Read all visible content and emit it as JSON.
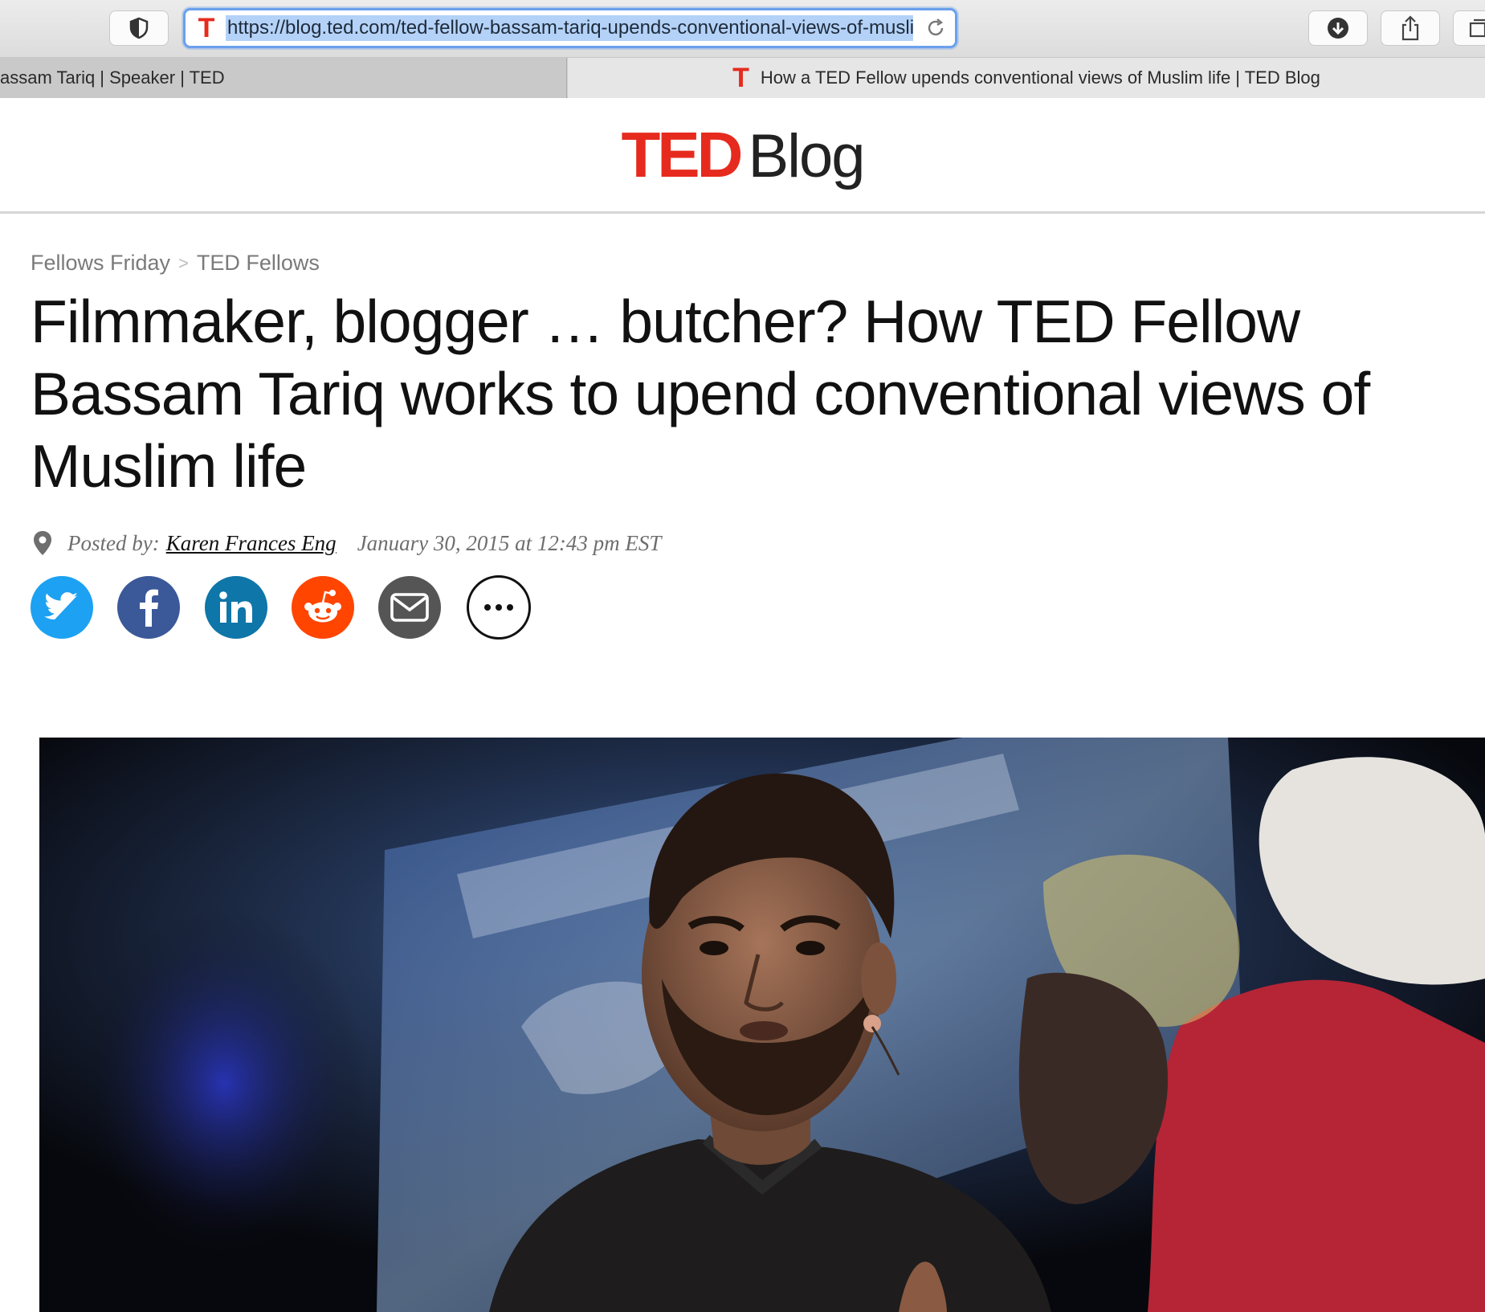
{
  "browser": {
    "url": "https://blog.ted.com/ted-fellow-bassam-tariq-upends-conventional-views-of-muslim-life/",
    "tabs": [
      {
        "title": "assam Tariq | Speaker | TED",
        "active": false
      },
      {
        "title": "How a TED Fellow upends conventional views of Muslim life | TED Blog",
        "active": true
      }
    ],
    "favicon_letter": "T"
  },
  "site": {
    "logo_ted": "TED",
    "logo_blog": "Blog",
    "brand_color": "#e62b1e"
  },
  "breadcrumb": {
    "parent": "Fellows Friday",
    "separator": ">",
    "current": "TED Fellows"
  },
  "article": {
    "title": "Filmmaker, blogger … butcher? How TED Fellow Bassam Tariq works to upend conventional views of Muslim life",
    "posted_by_label": "Posted by:",
    "author": "Karen Frances Eng",
    "date": "January 30, 2015 at 12:43 pm EST"
  },
  "share": [
    {
      "name": "twitter",
      "icon": "twitter-bird-icon",
      "color": "#1da1f2"
    },
    {
      "name": "facebook",
      "icon": "facebook-f-icon",
      "color": "#3b5998"
    },
    {
      "name": "linkedin",
      "icon": "linkedin-in-icon",
      "color": "#0e76a8"
    },
    {
      "name": "reddit",
      "icon": "reddit-alien-icon",
      "color": "#ff4500"
    },
    {
      "name": "email",
      "icon": "envelope-icon",
      "color": "#555555"
    },
    {
      "name": "more",
      "icon": "ellipsis-icon",
      "color": "#111111"
    }
  ]
}
